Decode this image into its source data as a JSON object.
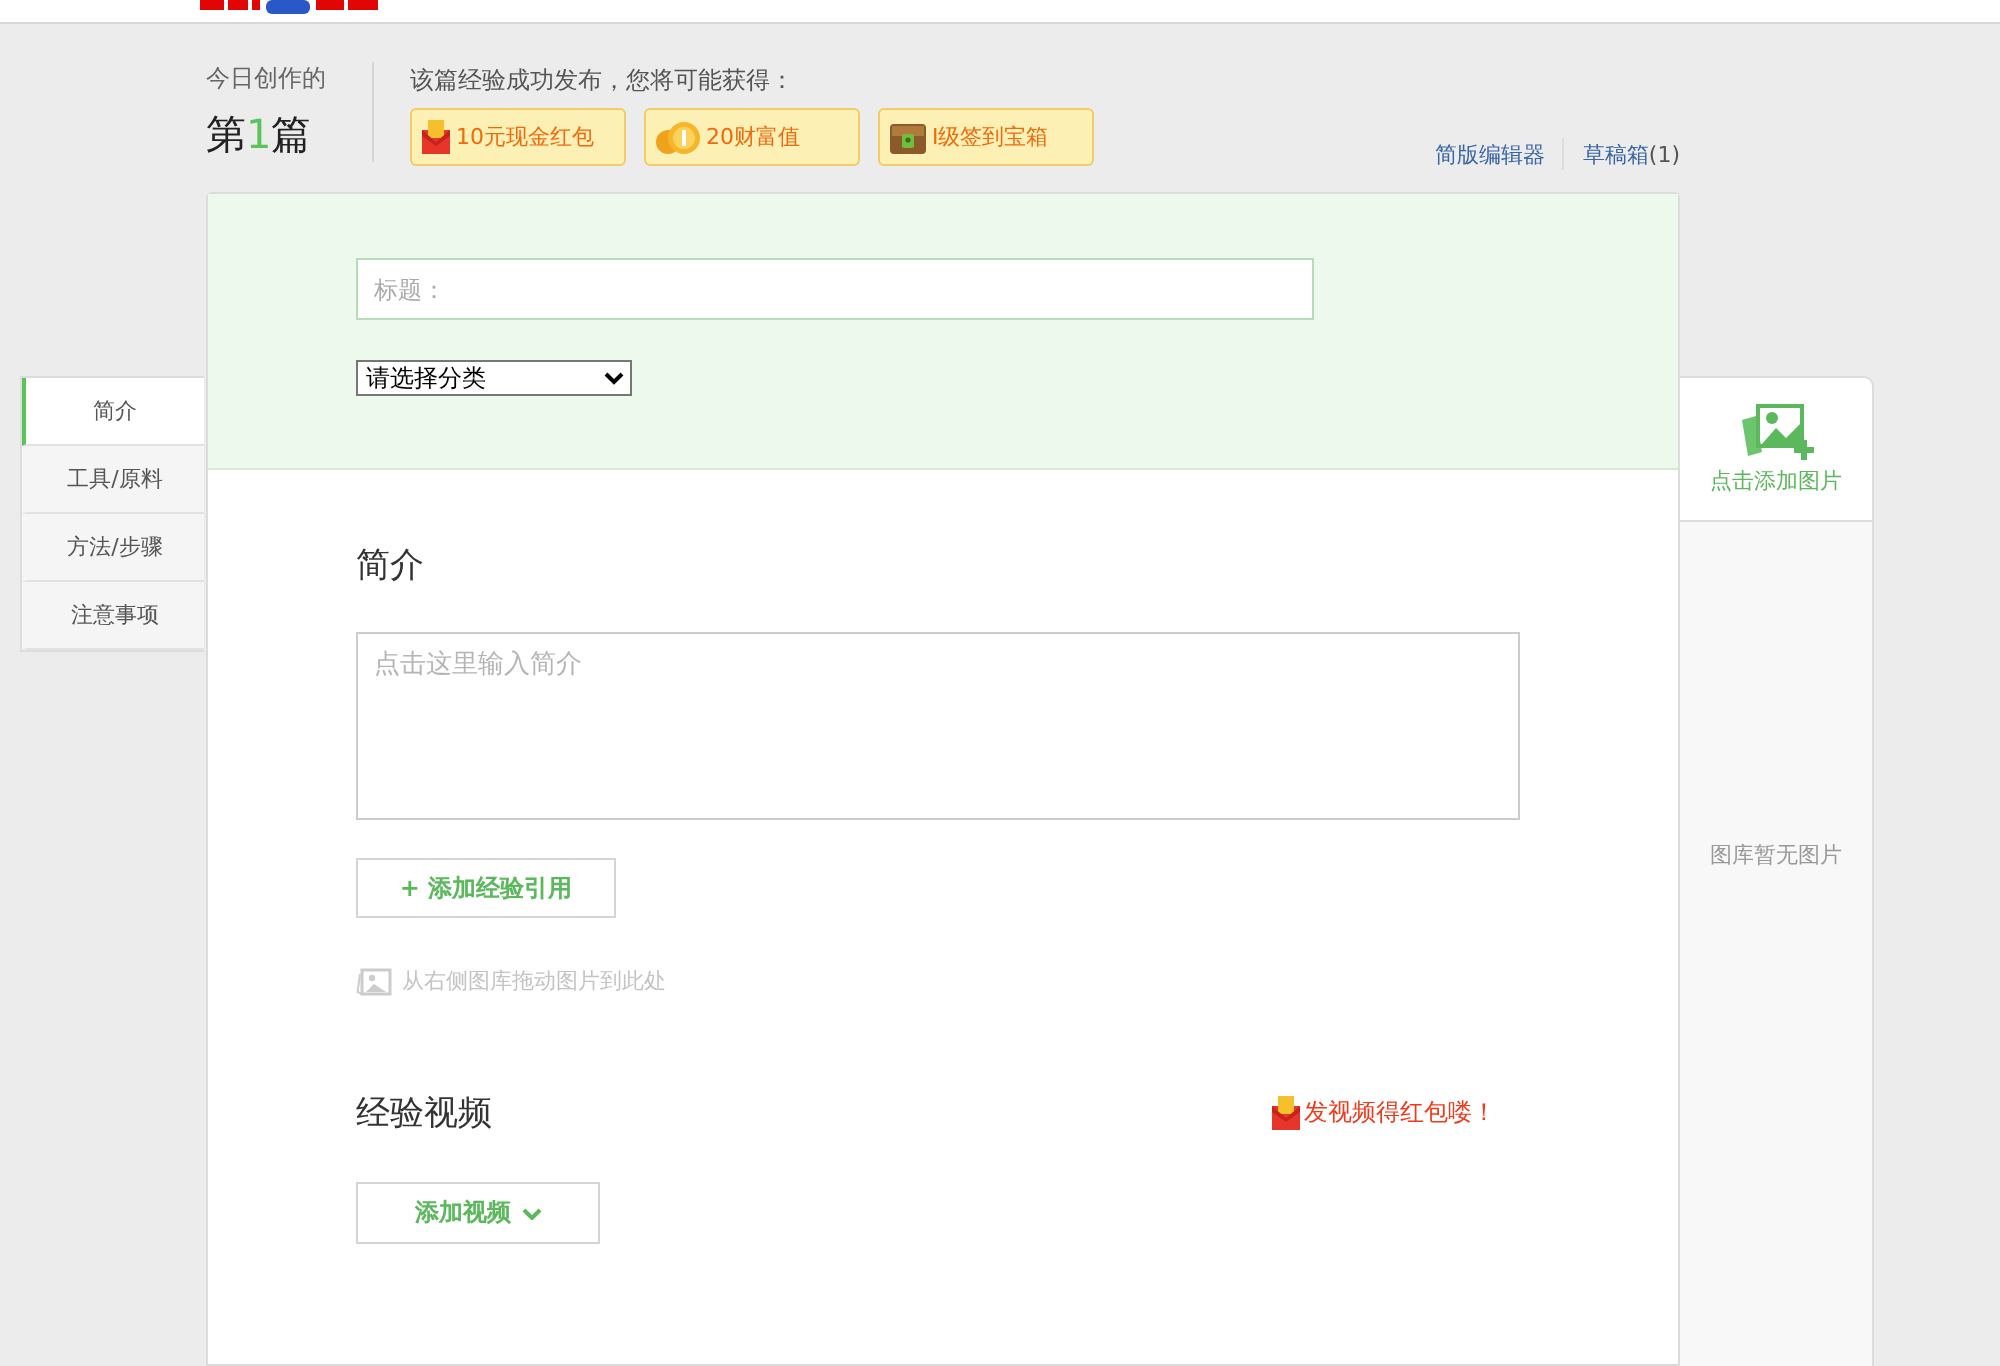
{
  "creation": {
    "label": "今日创作的",
    "count_prefix": "第",
    "count": "1",
    "count_suffix": "篇"
  },
  "rewards": {
    "intro": "该篇经验成功发布，您将可能获得：",
    "items": [
      {
        "kind": "redpacket",
        "label": "10元现金红包"
      },
      {
        "kind": "coins",
        "label": "20财富值"
      },
      {
        "kind": "chest",
        "label": "I级签到宝箱"
      }
    ]
  },
  "links": [
    {
      "label": "简版编辑器"
    },
    {
      "label": "草稿箱",
      "count": "(1)"
    }
  ],
  "nav": [
    {
      "label": "简介",
      "selected": true
    },
    {
      "label": "工具/原料",
      "selected": false
    },
    {
      "label": "方法/步骤",
      "selected": false
    },
    {
      "label": "注意事项",
      "selected": false
    }
  ],
  "form": {
    "title": {
      "placeholder": "标题："
    },
    "category": {
      "value": "请选择分类"
    }
  },
  "intro": {
    "heading": "简介",
    "placeholder": "点击这里输入简介",
    "cite_button": "+ 添加经验引用",
    "drag_hint": "从右侧图库拖动图片到此处"
  },
  "video": {
    "heading": "经验视频",
    "promo": "发视频得红包喽！",
    "button": "添加视频"
  },
  "gallery": {
    "add_label": "点击添加图片",
    "empty": "图库暂无图片"
  }
}
